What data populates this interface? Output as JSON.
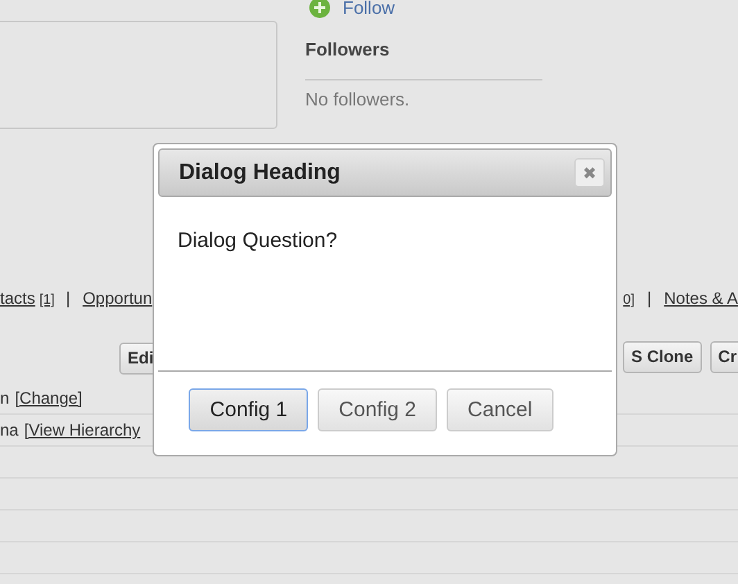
{
  "followers_panel": {
    "follow_link": "Follow",
    "heading": "Followers",
    "empty_text": "No followers."
  },
  "related_links_left": [
    {
      "kind": "link",
      "text": "tacts"
    },
    {
      "kind": "count",
      "text": "[1]"
    },
    {
      "kind": "separator",
      "text": "|"
    },
    {
      "kind": "link",
      "text": "Opportun"
    }
  ],
  "related_links_right": [
    {
      "kind": "count",
      "text": "0]"
    },
    {
      "kind": "separator",
      "text": "|"
    },
    {
      "kind": "link",
      "text": "Notes & A"
    }
  ],
  "toolbar_left": [
    "Edi"
  ],
  "toolbar_right": [
    "S Clone",
    "Cr"
  ],
  "detail_rows": [
    {
      "text": "n",
      "link": "[Change]"
    },
    {
      "text": "na",
      "link": "[View Hierarchy"
    }
  ],
  "dialog": {
    "title": "Dialog Heading",
    "close_glyph": "✖",
    "question": "Dialog Question?",
    "buttons": [
      {
        "label": "Config 1",
        "focused": true
      },
      {
        "label": "Config 2",
        "focused": false
      },
      {
        "label": "Cancel",
        "focused": false
      }
    ]
  }
}
